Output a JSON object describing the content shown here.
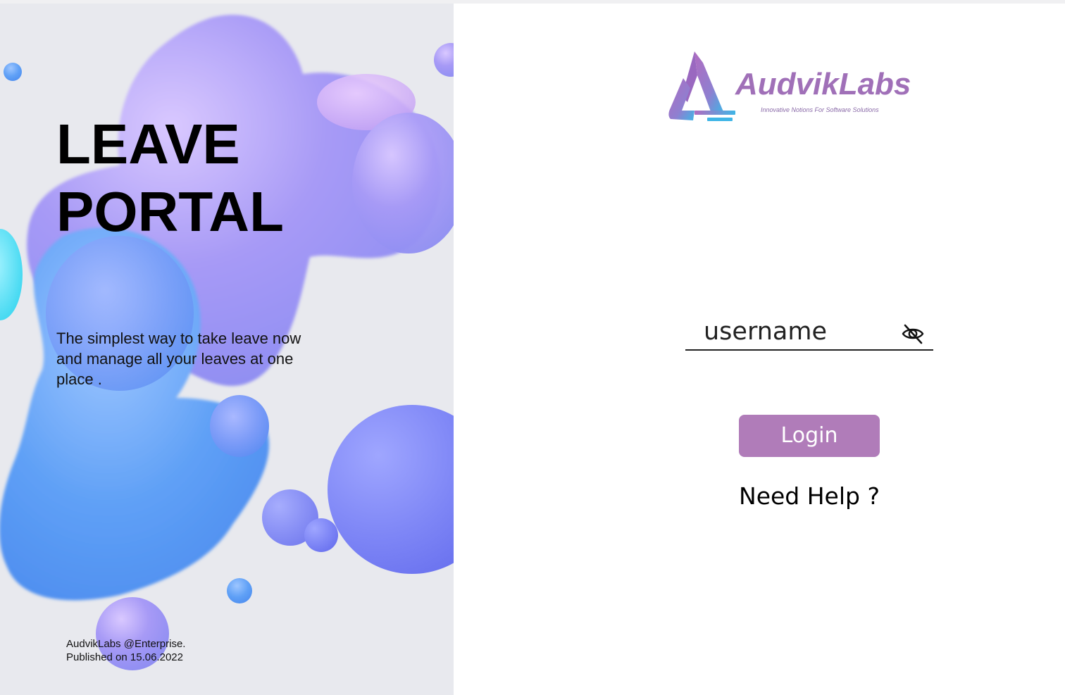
{
  "hero": {
    "title_line1": "LEAVE",
    "title_line2": "PORTAL",
    "tagline": "The simplest way to take leave now and manage all your leaves at one place ."
  },
  "footer": {
    "line1": "AudvikLabs @Enterprise.",
    "line2": "Published on 15.06.2022"
  },
  "brand": {
    "name": "AudvikLabs",
    "tagline": "Innovative Notions For Software Solutions",
    "color": "#a070b8"
  },
  "login_form": {
    "username_placeholder": "username",
    "visibility_icon": "eye-slash-icon",
    "login_label": "Login",
    "help_label": "Need Help ?",
    "button_color": "#b07cb9"
  }
}
